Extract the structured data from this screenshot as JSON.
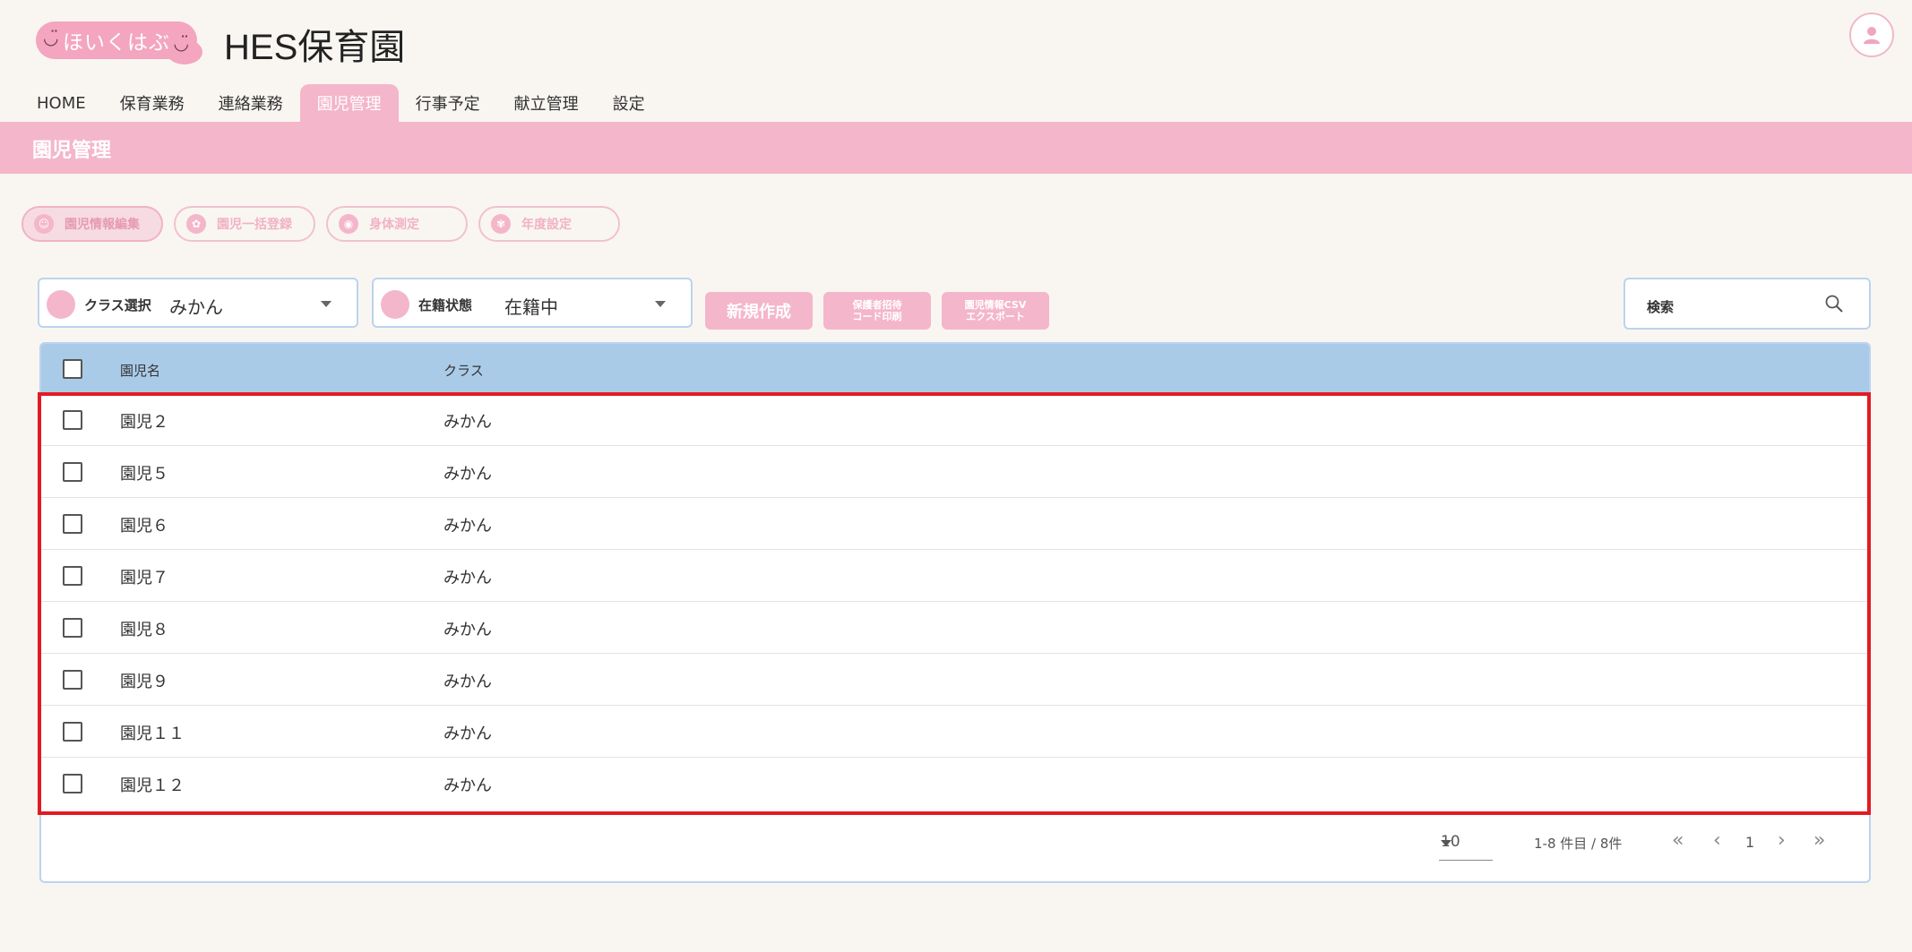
{
  "header": {
    "logo_text": "ほいくはぶ",
    "site_title": "HES保育園"
  },
  "nav": {
    "tabs": [
      "HOME",
      "保育業務",
      "連絡業務",
      "園児管理",
      "行事予定",
      "献立管理",
      "設定"
    ],
    "active_index": 3
  },
  "page_title": "園児管理",
  "subtabs": [
    "園児情報編集",
    "園児一括登録",
    "身体測定",
    "年度設定"
  ],
  "filters": {
    "class_label": "クラス選択",
    "class_value": "みかん",
    "status_label": "在籍状態",
    "status_value": "在籍中"
  },
  "actions": {
    "new_label": "新規作成",
    "print_label_line1": "保護者招待",
    "print_label_line2": "コード印刷",
    "export_label_line1": "園児情報CSV",
    "export_label_line2": "エクスポート"
  },
  "search": {
    "label": "検索"
  },
  "table": {
    "columns": [
      "園児名",
      "クラス"
    ],
    "rows": [
      {
        "name": "園児２",
        "class": "みかん"
      },
      {
        "name": "園児５",
        "class": "みかん"
      },
      {
        "name": "園児６",
        "class": "みかん"
      },
      {
        "name": "園児７",
        "class": "みかん"
      },
      {
        "name": "園児８",
        "class": "みかん"
      },
      {
        "name": "園児９",
        "class": "みかん"
      },
      {
        "name": "園児１１",
        "class": "みかん"
      },
      {
        "name": "園児１２",
        "class": "みかん"
      }
    ]
  },
  "pagination": {
    "per_page": "10",
    "range_text": "1-8 件目 / 8件",
    "current_page": "1"
  },
  "colors": {
    "accent_pink": "#f4b6ca",
    "table_header": "#aacbe8",
    "highlight_red": "#e21b23"
  }
}
